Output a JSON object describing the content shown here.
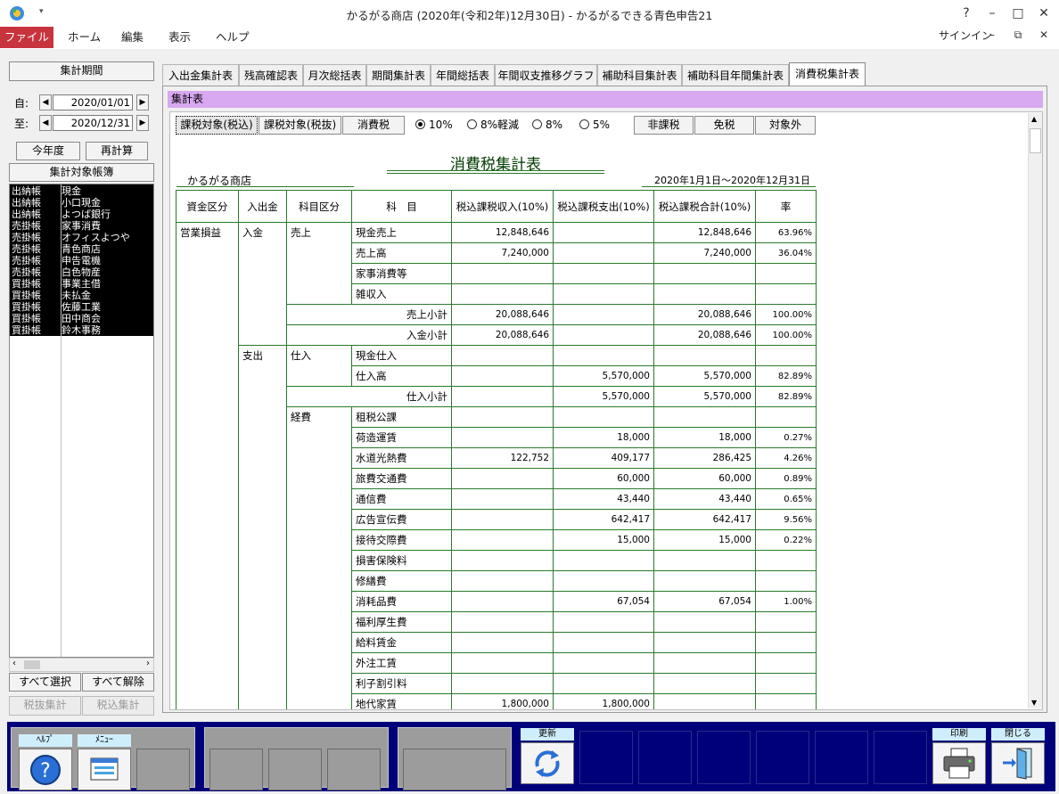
{
  "window": {
    "title": "かるがる商店 (2020年(令和2年)12月30日) - かるがるできる青色申告21",
    "help": "?",
    "minimize": "–",
    "maximize": "□",
    "close": "✕"
  },
  "ribbon": {
    "file": "ファイル",
    "menus": [
      "ホーム",
      "編集",
      "表示",
      "ヘルプ"
    ],
    "signin": "サインイン",
    "restore": "⧉",
    "minimize": "–",
    "close": "✕"
  },
  "left": {
    "period_header": "集計期間",
    "from_label": "自:",
    "from_date": "2020/01/01",
    "to_label": "至:",
    "to_date": "2020/12/31",
    "this_year": "今年度",
    "recalc": "再計算",
    "ledger_header": "集計対象帳簿",
    "ledgers": [
      {
        "type": "出納帳",
        "name": "現金"
      },
      {
        "type": "出納帳",
        "name": "小口現金"
      },
      {
        "type": "出納帳",
        "name": "よつば銀行"
      },
      {
        "type": "売掛帳",
        "name": "家事消費"
      },
      {
        "type": "売掛帳",
        "name": "オフィスよつや"
      },
      {
        "type": "売掛帳",
        "name": "青色商店"
      },
      {
        "type": "売掛帳",
        "name": "申告電機"
      },
      {
        "type": "売掛帳",
        "name": "白色物産"
      },
      {
        "type": "買掛帳",
        "name": "事業主借"
      },
      {
        "type": "買掛帳",
        "name": "未払金"
      },
      {
        "type": "買掛帳",
        "name": "佐藤工業"
      },
      {
        "type": "買掛帳",
        "name": "田中商会"
      },
      {
        "type": "買掛帳",
        "name": "鈴木事務"
      }
    ],
    "select_all": "すべて選択",
    "deselect_all": "すべて解除",
    "tax_excl": "税抜集計",
    "tax_incl": "税込集計"
  },
  "tabs": [
    "入出金集計表",
    "残高確認表",
    "月次総括表",
    "期間集計表",
    "年間総括表",
    "年間収支推移グラフ",
    "補助科目集計表",
    "補助科目年間集計表",
    "消費税集計表"
  ],
  "section_title": "集計表",
  "toolbar": {
    "btn_incl": "課税対象(税込)",
    "btn_excl": "課税対象(税抜)",
    "btn_tax": "消費税",
    "radios": [
      "10%",
      "8%軽減",
      "8%",
      "5%"
    ],
    "btn_nontax": "非課税",
    "btn_exempt": "免税",
    "btn_out": "対象外"
  },
  "report": {
    "title": "消費税集計表",
    "company": "かるがる商店",
    "period": "2020年1月1日～2020年12月31日",
    "headers": [
      "資金区分",
      "入出金",
      "科目区分",
      "科　目",
      "税込課税収入(10%)",
      "税込課税支出(10%)",
      "税込課税合計(10%)",
      "率"
    ],
    "group_label": "営業損益",
    "in_label": "入金",
    "out_label": "支出",
    "sales_label": "売上",
    "purchase_label": "仕入",
    "expense_label": "経費",
    "sales_rows": [
      {
        "name": "現金売上",
        "income": "12,848,646",
        "expense": "",
        "total": "12,848,646",
        "rate": "63.96%"
      },
      {
        "name": "売上高",
        "income": "7,240,000",
        "expense": "",
        "total": "7,240,000",
        "rate": "36.04%"
      },
      {
        "name": "家事消費等",
        "income": "",
        "expense": "",
        "total": "",
        "rate": ""
      },
      {
        "name": "雑収入",
        "income": "",
        "expense": "",
        "total": "",
        "rate": ""
      }
    ],
    "sales_subtotal": {
      "name": "売上小計",
      "income": "20,088,646",
      "expense": "",
      "total": "20,088,646",
      "rate": "100.00%"
    },
    "in_subtotal": {
      "name": "入金小計",
      "income": "20,088,646",
      "expense": "",
      "total": "20,088,646",
      "rate": "100.00%"
    },
    "purchase_rows": [
      {
        "name": "現金仕入",
        "income": "",
        "expense": "",
        "total": "",
        "rate": ""
      },
      {
        "name": "仕入高",
        "income": "",
        "expense": "5,570,000",
        "total": "5,570,000",
        "rate": "82.89%"
      }
    ],
    "purchase_subtotal": {
      "name": "仕入小計",
      "income": "",
      "expense": "5,570,000",
      "total": "5,570,000",
      "rate": "82.89%"
    },
    "expense_rows": [
      {
        "name": "租税公課",
        "income": "",
        "expense": "",
        "total": "",
        "rate": ""
      },
      {
        "name": "荷造運賃",
        "income": "",
        "expense": "18,000",
        "total": "18,000",
        "rate": "0.27%"
      },
      {
        "name": "水道光熱費",
        "income": "122,752",
        "expense": "409,177",
        "total": "286,425",
        "rate": "4.26%"
      },
      {
        "name": "旅費交通費",
        "income": "",
        "expense": "60,000",
        "total": "60,000",
        "rate": "0.89%"
      },
      {
        "name": "通信費",
        "income": "",
        "expense": "43,440",
        "total": "43,440",
        "rate": "0.65%"
      },
      {
        "name": "広告宣伝費",
        "income": "",
        "expense": "642,417",
        "total": "642,417",
        "rate": "9.56%"
      },
      {
        "name": "接待交際費",
        "income": "",
        "expense": "15,000",
        "total": "15,000",
        "rate": "0.22%"
      },
      {
        "name": "損害保険料",
        "income": "",
        "expense": "",
        "total": "",
        "rate": ""
      },
      {
        "name": "修繕費",
        "income": "",
        "expense": "",
        "total": "",
        "rate": ""
      },
      {
        "name": "消耗品費",
        "income": "",
        "expense": "67,054",
        "total": "67,054",
        "rate": "1.00%"
      },
      {
        "name": "福利厚生費",
        "income": "",
        "expense": "",
        "total": "",
        "rate": ""
      },
      {
        "name": "給料賃金",
        "income": "",
        "expense": "",
        "total": "",
        "rate": ""
      },
      {
        "name": "外注工賃",
        "income": "",
        "expense": "",
        "total": "",
        "rate": ""
      },
      {
        "name": "利子割引料",
        "income": "",
        "expense": "",
        "total": "",
        "rate": ""
      },
      {
        "name": "地代家賃",
        "income": "1,800,000",
        "expense": "1,800,000",
        "total": "",
        "rate": ""
      }
    ]
  },
  "bottom": {
    "help": "ﾍﾙﾌﾟ",
    "menu": "ﾒﾆｭｰ",
    "refresh": "更新",
    "print": "印刷",
    "close": "閉じる"
  }
}
